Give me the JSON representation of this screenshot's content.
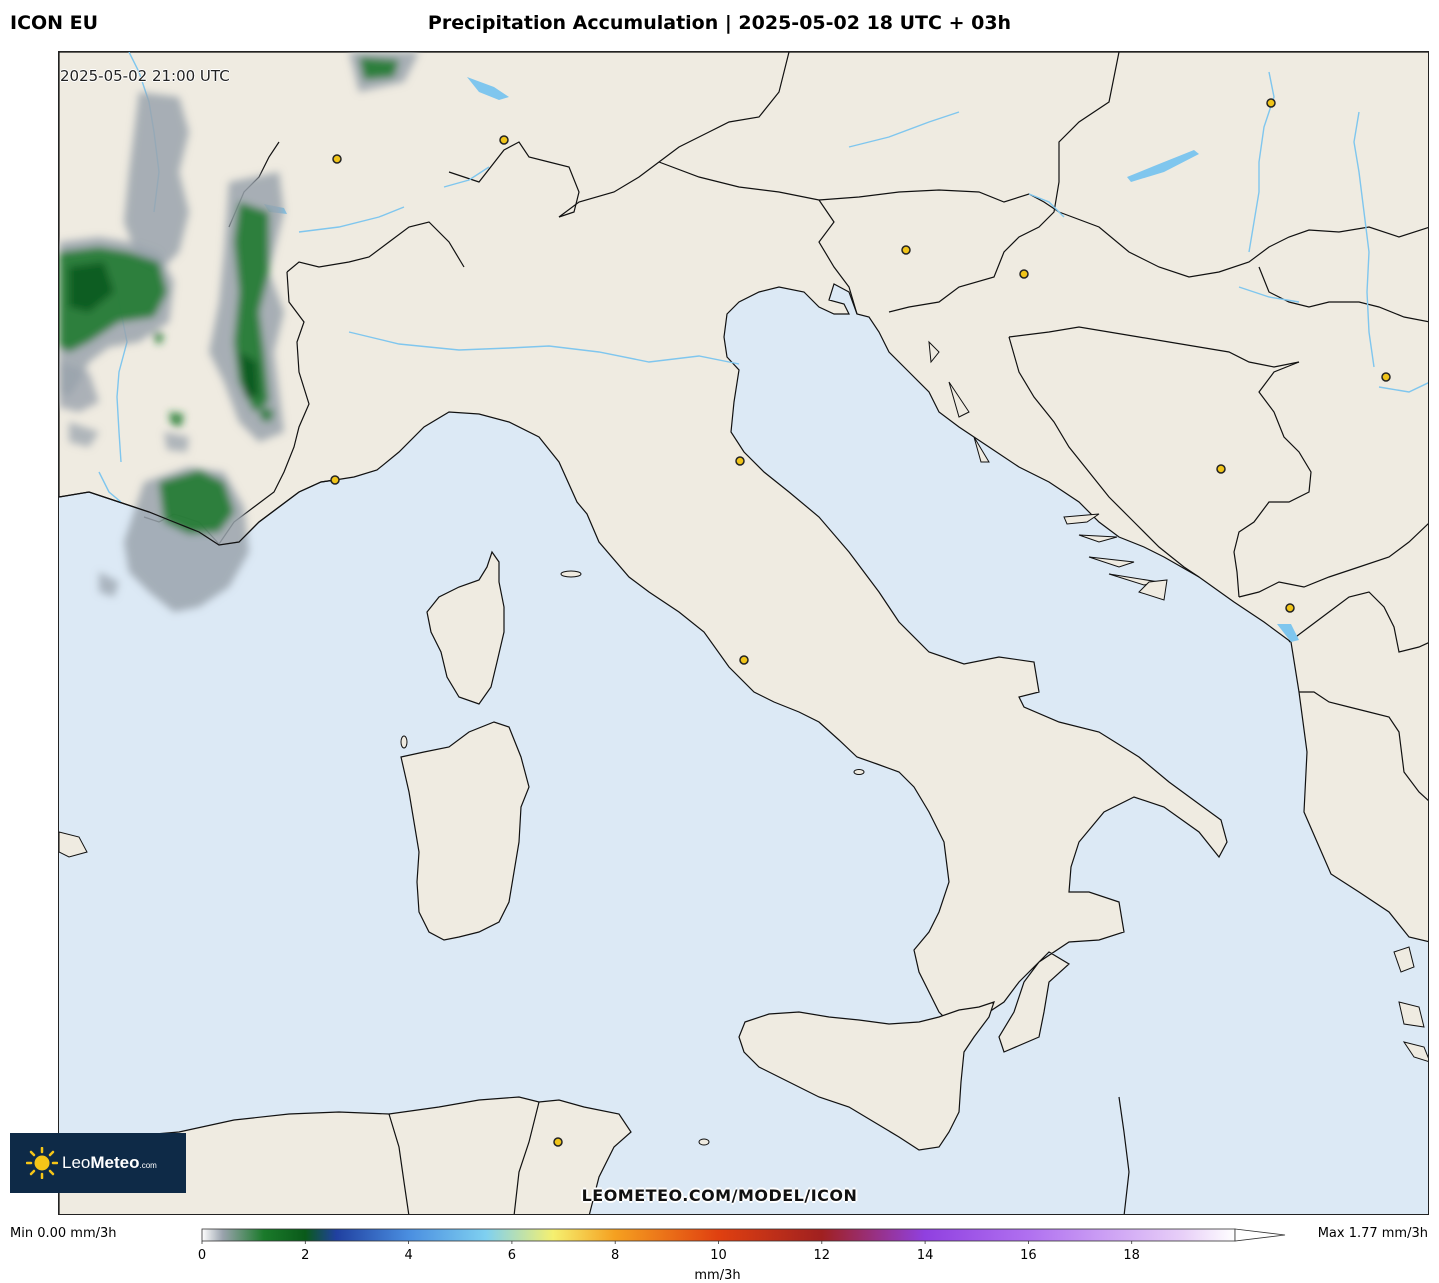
{
  "header": {
    "model": "ICON EU",
    "title": "Precipitation Accumulation | 2025-05-02 18 UTC + 03h"
  },
  "map": {
    "valid_time": "2025-05-02 21:00 UTC",
    "watermark": "LEOMETEO.COM/MODEL/ICON",
    "colors": {
      "sea": "#dce9f5",
      "land": "#efebe1",
      "border": "#000000",
      "river": "#7fc6ee",
      "city_marker": "#f0c419"
    },
    "precipitation_areas": [
      "western Alps",
      "southeastern France",
      "Provence coast"
    ]
  },
  "logo": {
    "brand_light": "Leo",
    "brand_bold": "Meteo",
    "brand_suffix": ".com",
    "icon": "sun-icon"
  },
  "legend": {
    "min_label": "Min 0.00 mm/3h",
    "max_label": "Max 1.77 mm/3h",
    "unit": "mm/3h",
    "range": [
      0,
      20
    ],
    "ticks": [
      "0",
      "2",
      "4",
      "6",
      "8",
      "10",
      "12",
      "14",
      "16",
      "18"
    ],
    "tick_values": [
      0,
      2,
      4,
      6,
      8,
      10,
      12,
      14,
      16,
      18
    ],
    "gradient_stops": [
      {
        "v": 0,
        "c": "#ffffff"
      },
      {
        "v": 0.4,
        "c": "#9aa3ad"
      },
      {
        "v": 1.2,
        "c": "#1a7a2a"
      },
      {
        "v": 2,
        "c": "#0a5a1a"
      },
      {
        "v": 2.6,
        "c": "#2040a0"
      },
      {
        "v": 4,
        "c": "#4a8ee0"
      },
      {
        "v": 5.5,
        "c": "#7fd0f0"
      },
      {
        "v": 6.8,
        "c": "#f5f070"
      },
      {
        "v": 8,
        "c": "#f5a020"
      },
      {
        "v": 10,
        "c": "#e04010"
      },
      {
        "v": 12,
        "c": "#a02020"
      },
      {
        "v": 14,
        "c": "#9040e0"
      },
      {
        "v": 16,
        "c": "#b070f0"
      },
      {
        "v": 19,
        "c": "#e8d0f8"
      },
      {
        "v": 20,
        "c": "#ffffff"
      }
    ]
  }
}
